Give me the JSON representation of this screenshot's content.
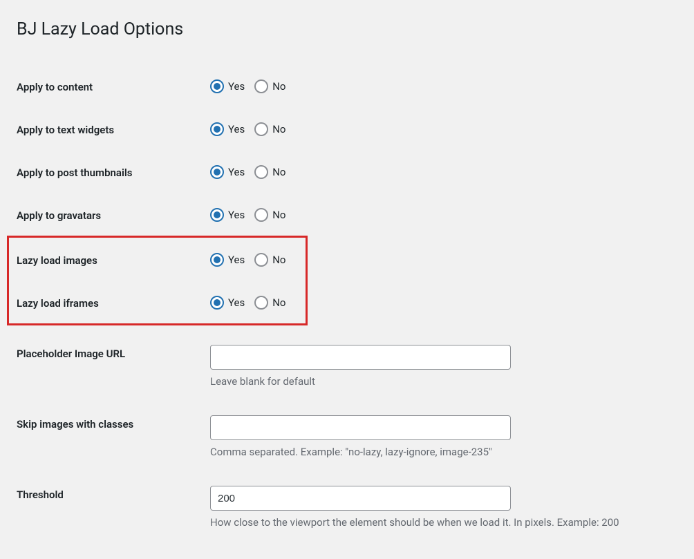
{
  "page": {
    "title": "BJ Lazy Load Options"
  },
  "options": {
    "yes": "Yes",
    "no": "No"
  },
  "fields": {
    "apply_content": {
      "label": "Apply to content",
      "value": "yes"
    },
    "apply_text_widgets": {
      "label": "Apply to text widgets",
      "value": "yes"
    },
    "apply_post_thumbnails": {
      "label": "Apply to post thumbnails",
      "value": "yes"
    },
    "apply_gravatars": {
      "label": "Apply to gravatars",
      "value": "yes"
    },
    "lazy_images": {
      "label": "Lazy load images",
      "value": "yes"
    },
    "lazy_iframes": {
      "label": "Lazy load iframes",
      "value": "yes"
    },
    "placeholder_url": {
      "label": "Placeholder Image URL",
      "value": "",
      "description": "Leave blank for default"
    },
    "skip_classes": {
      "label": "Skip images with classes",
      "value": "",
      "description": "Comma separated. Example: \"no-lazy, lazy-ignore, image-235\""
    },
    "threshold": {
      "label": "Threshold",
      "value": "200",
      "description": "How close to the viewport the element should be when we load it. In pixels. Example: 200"
    }
  }
}
